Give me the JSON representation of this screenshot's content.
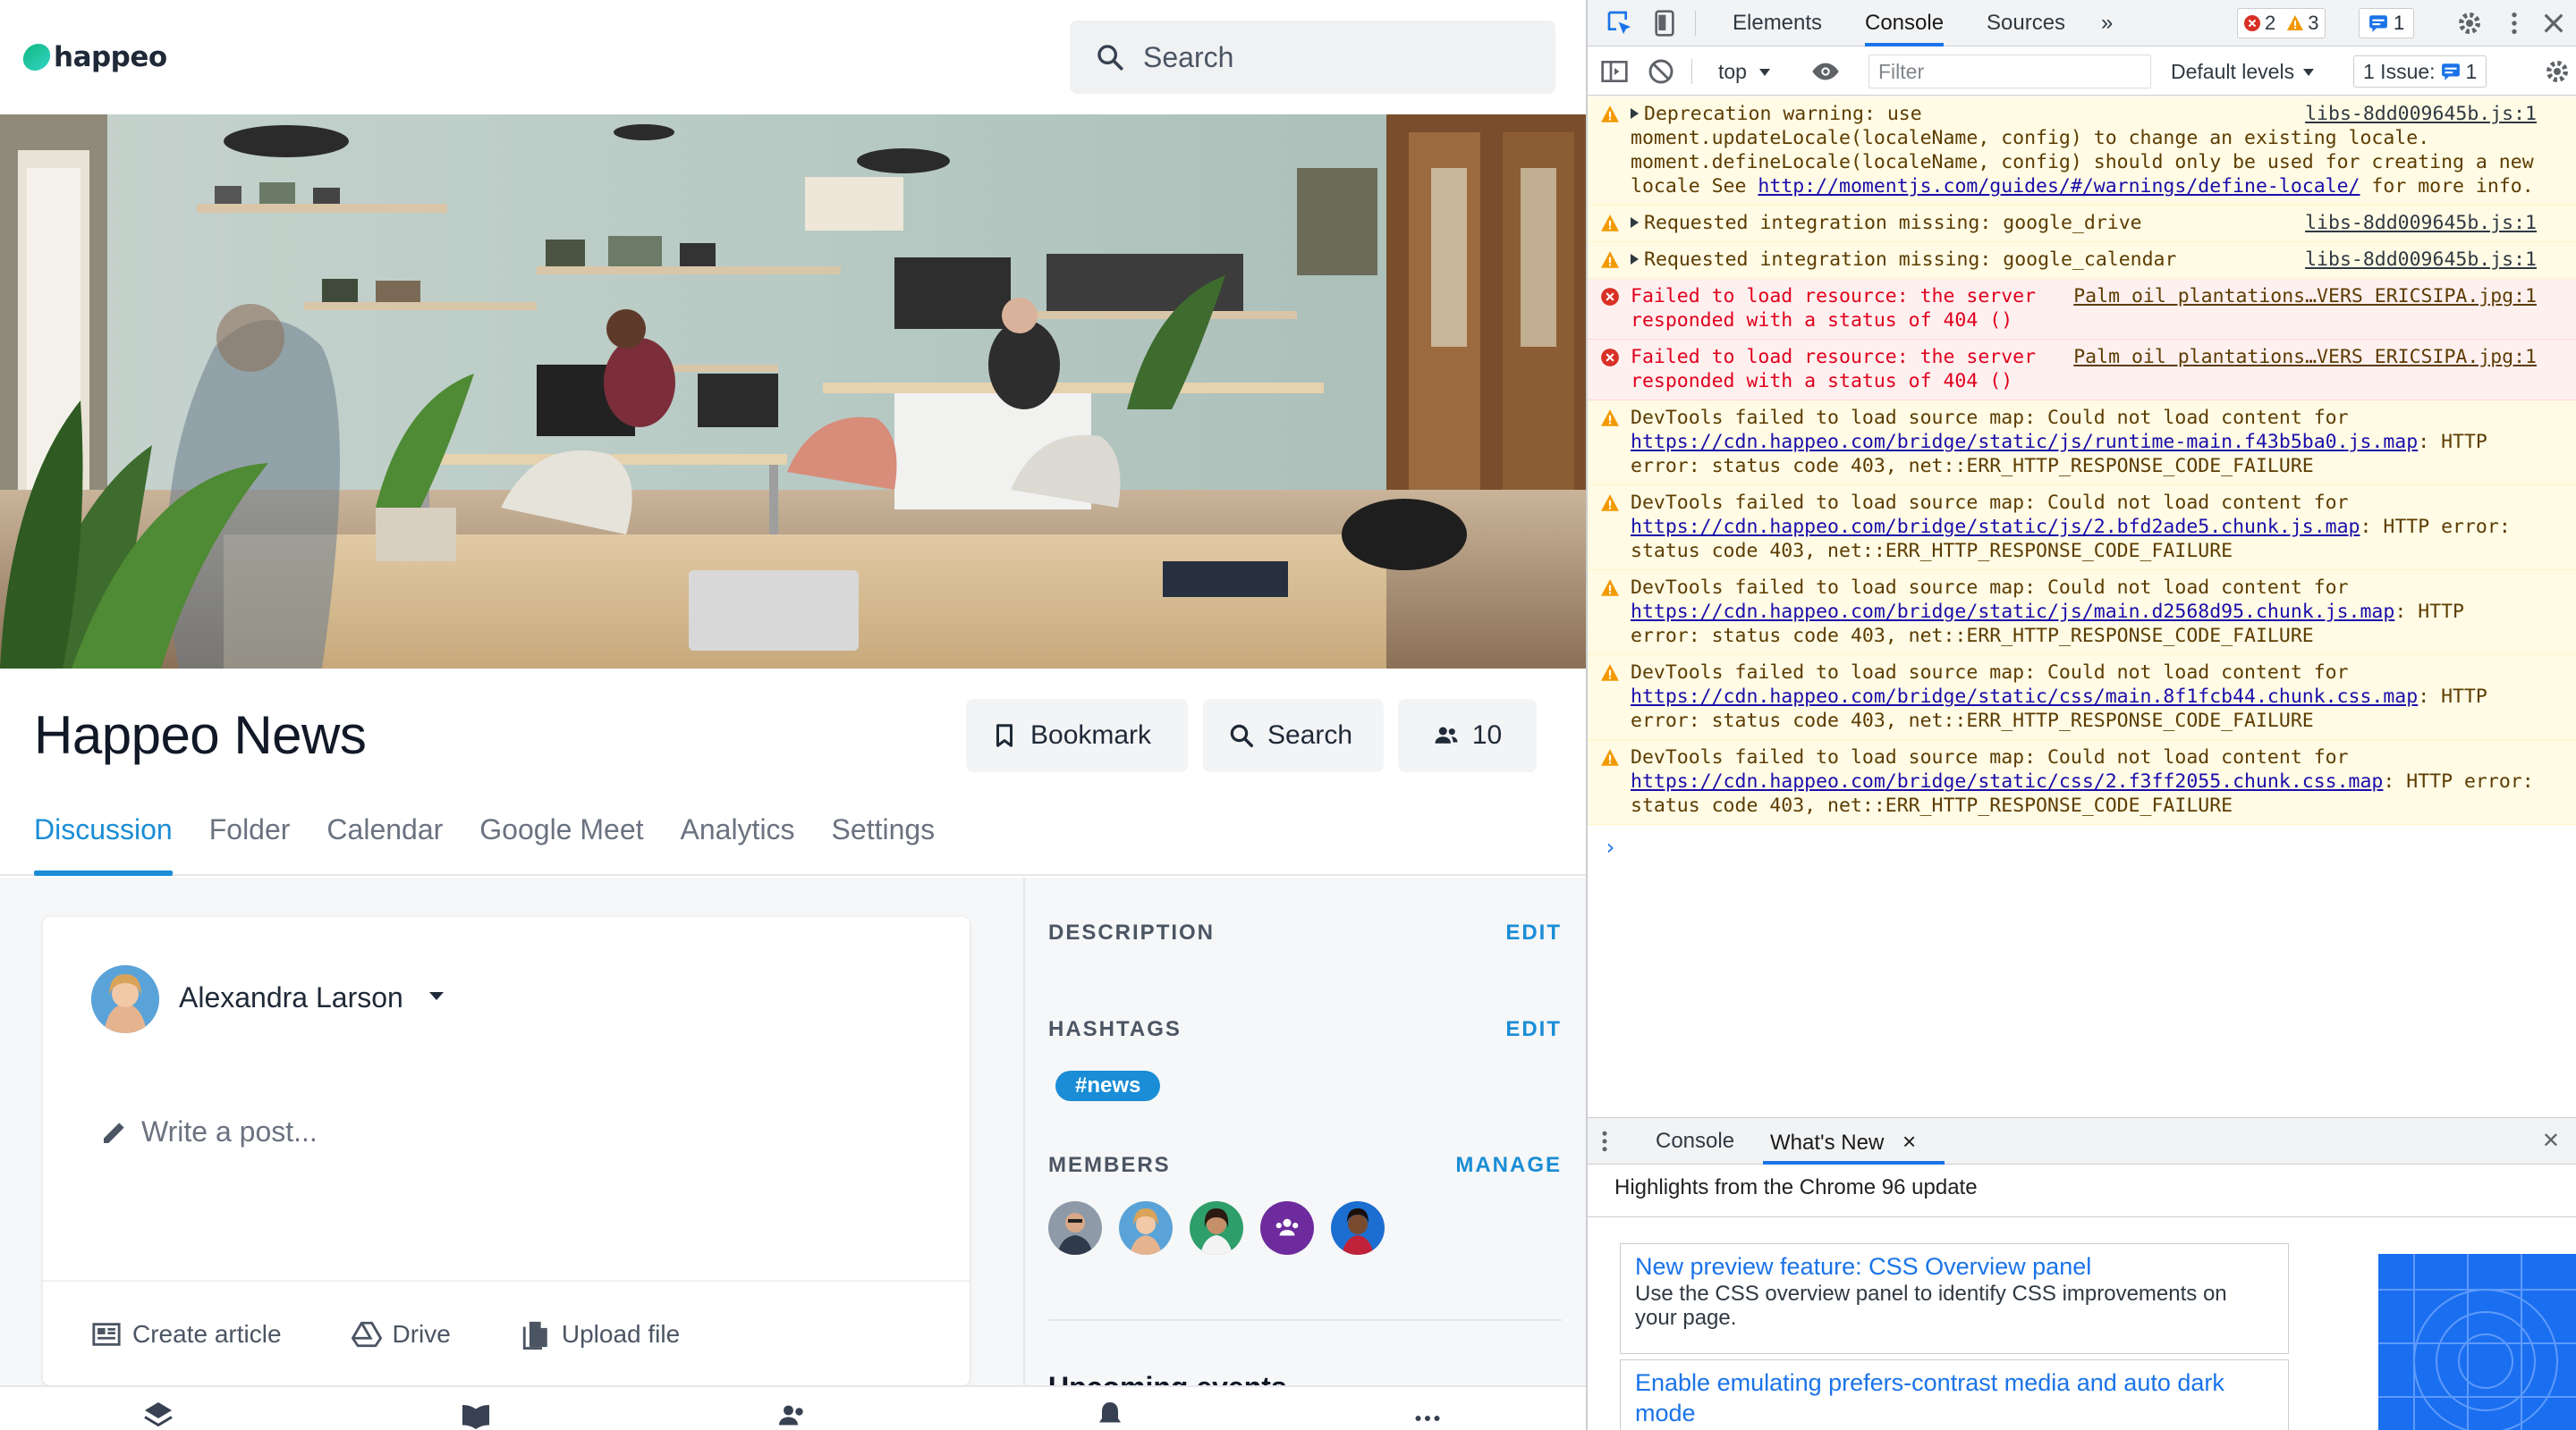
{
  "app": {
    "logo_text": "happeo",
    "search_placeholder": "Search",
    "page_title": "Happeo News",
    "header_buttons": {
      "bookmark": "Bookmark",
      "search": "Search",
      "members_count": "10"
    },
    "tabs": [
      "Discussion",
      "Folder",
      "Calendar",
      "Google Meet",
      "Analytics",
      "Settings"
    ],
    "active_tab": "Discussion",
    "composer": {
      "author": "Alexandra Larson",
      "placeholder": "Write a post...",
      "actions": [
        "Create article",
        "Drive",
        "Upload file"
      ]
    },
    "sidebar": {
      "description_heading": "DESCRIPTION",
      "description_action": "EDIT",
      "hashtags_heading": "HASHTAGS",
      "hashtags_action": "EDIT",
      "hashtags": [
        "#news"
      ],
      "members_heading": "MEMBERS",
      "members_action": "MANAGE",
      "upcoming_heading": "Upcoming events"
    },
    "colors": {
      "accent": "#1a8dd6",
      "brand": "#10b981"
    }
  },
  "devtools": {
    "tabs": [
      "Elements",
      "Console",
      "Sources"
    ],
    "active_tab": "Console",
    "more": "»",
    "counts": {
      "errors": "2",
      "warnings": "3",
      "messages": "1"
    },
    "toolbar": {
      "context": "top",
      "filter_placeholder": "Filter",
      "levels": "Default levels",
      "issues_label": "1 Issue:",
      "issues_count": "1"
    },
    "messages": [
      {
        "level": "warn",
        "expand": true,
        "text": "Deprecation warning: use moment.updateLocale(localeName, config) to change an existing locale. moment.defineLocale(localeName, config) should only be used for creating a new locale See ",
        "link": "http://momentjs.com/guides/#/warnings/define-locale/",
        "tail": " for more info.",
        "source": "libs-8dd009645b.js:1"
      },
      {
        "level": "warn",
        "expand": true,
        "text": "Requested integration missing: google_drive",
        "source": "libs-8dd009645b.js:1"
      },
      {
        "level": "warn",
        "expand": true,
        "text": "Requested integration missing: google_calendar",
        "source": "libs-8dd009645b.js:1"
      },
      {
        "level": "err",
        "expand": false,
        "text": "Failed to load resource: the server responded with a status of 404 ()",
        "source": "Palm oil plantations…VERS ERICSIPA.jpg:1"
      },
      {
        "level": "err",
        "expand": false,
        "text": "Failed to load resource: the server responded with a status of 404 ()",
        "source": "Palm oil plantations…VERS ERICSIPA.jpg:1"
      },
      {
        "level": "warn",
        "expand": false,
        "text": "DevTools failed to load source map: Could not load content for ",
        "link": "https://cdn.happeo.com/bridge/static/js/runtime-main.f43b5ba0.js.map",
        "tail": ": HTTP error: status code 403, net::ERR_HTTP_RESPONSE_CODE_FAILURE"
      },
      {
        "level": "warn",
        "expand": false,
        "text": "DevTools failed to load source map: Could not load content for ",
        "link": "https://cdn.happeo.com/bridge/static/js/2.bfd2ade5.chunk.js.map",
        "tail": ": HTTP error: status code 403, net::ERR_HTTP_RESPONSE_CODE_FAILURE"
      },
      {
        "level": "warn",
        "expand": false,
        "text": "DevTools failed to load source map: Could not load content for ",
        "link": "https://cdn.happeo.com/bridge/static/js/main.d2568d95.chunk.js.map",
        "tail": ": HTTP error: status code 403, net::ERR_HTTP_RESPONSE_CODE_FAILURE"
      },
      {
        "level": "warn",
        "expand": false,
        "text": "DevTools failed to load source map: Could not load content for ",
        "link": "https://cdn.happeo.com/bridge/static/css/main.8f1fcb44.chunk.css.map",
        "tail": ": HTTP error: status code 403, net::ERR_HTTP_RESPONSE_CODE_FAILURE"
      },
      {
        "level": "warn",
        "expand": false,
        "text": "DevTools failed to load source map: Could not load content for ",
        "link": "https://cdn.happeo.com/bridge/static/css/2.f3ff2055.chunk.css.map",
        "tail": ": HTTP error: status code 403, net::ERR_HTTP_RESPONSE_CODE_FAILURE"
      }
    ],
    "prompt": "›",
    "drawer": {
      "tabs": [
        "Console",
        "What's New"
      ],
      "active_tab": "What's New",
      "close_tab": "×",
      "close_drawer": "✕",
      "highlights": "Highlights from the Chrome 96 update",
      "cards": [
        {
          "title": "New preview feature: CSS Overview panel",
          "desc": "Use the CSS overview panel to identify CSS improvements on your page."
        },
        {
          "title": "Enable emulating prefers-contrast media and auto dark mode",
          "desc": ""
        }
      ]
    }
  }
}
